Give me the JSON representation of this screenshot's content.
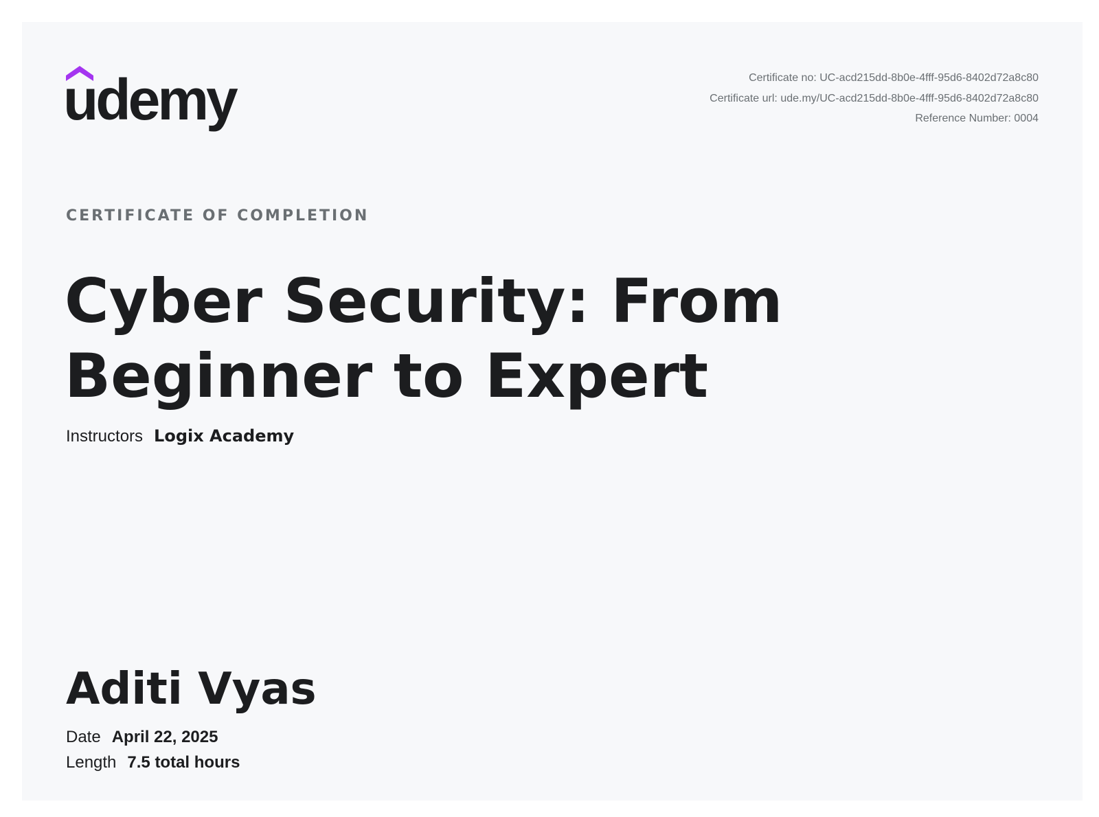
{
  "brand": {
    "name": "udemy",
    "accent_color": "#a435f0",
    "text_color": "#1c1d1f"
  },
  "meta": {
    "certificate_no": "Certificate no: UC-acd215dd-8b0e-4fff-95d6-8402d72a8c80",
    "certificate_url": "Certificate url: ude.my/UC-acd215dd-8b0e-4fff-95d6-8402d72a8c80",
    "reference_number": "Reference Number: 0004"
  },
  "certificate": {
    "eyebrow": "CERTIFICATE OF COMPLETION",
    "course_title": "Cyber Security: From Beginner to Expert",
    "instructors_label": "Instructors",
    "instructors_value": "Logix Academy",
    "recipient_name": "Aditi Vyas",
    "date_label": "Date",
    "date_value": "April 22, 2025",
    "length_label": "Length",
    "length_value": "7.5 total hours"
  }
}
